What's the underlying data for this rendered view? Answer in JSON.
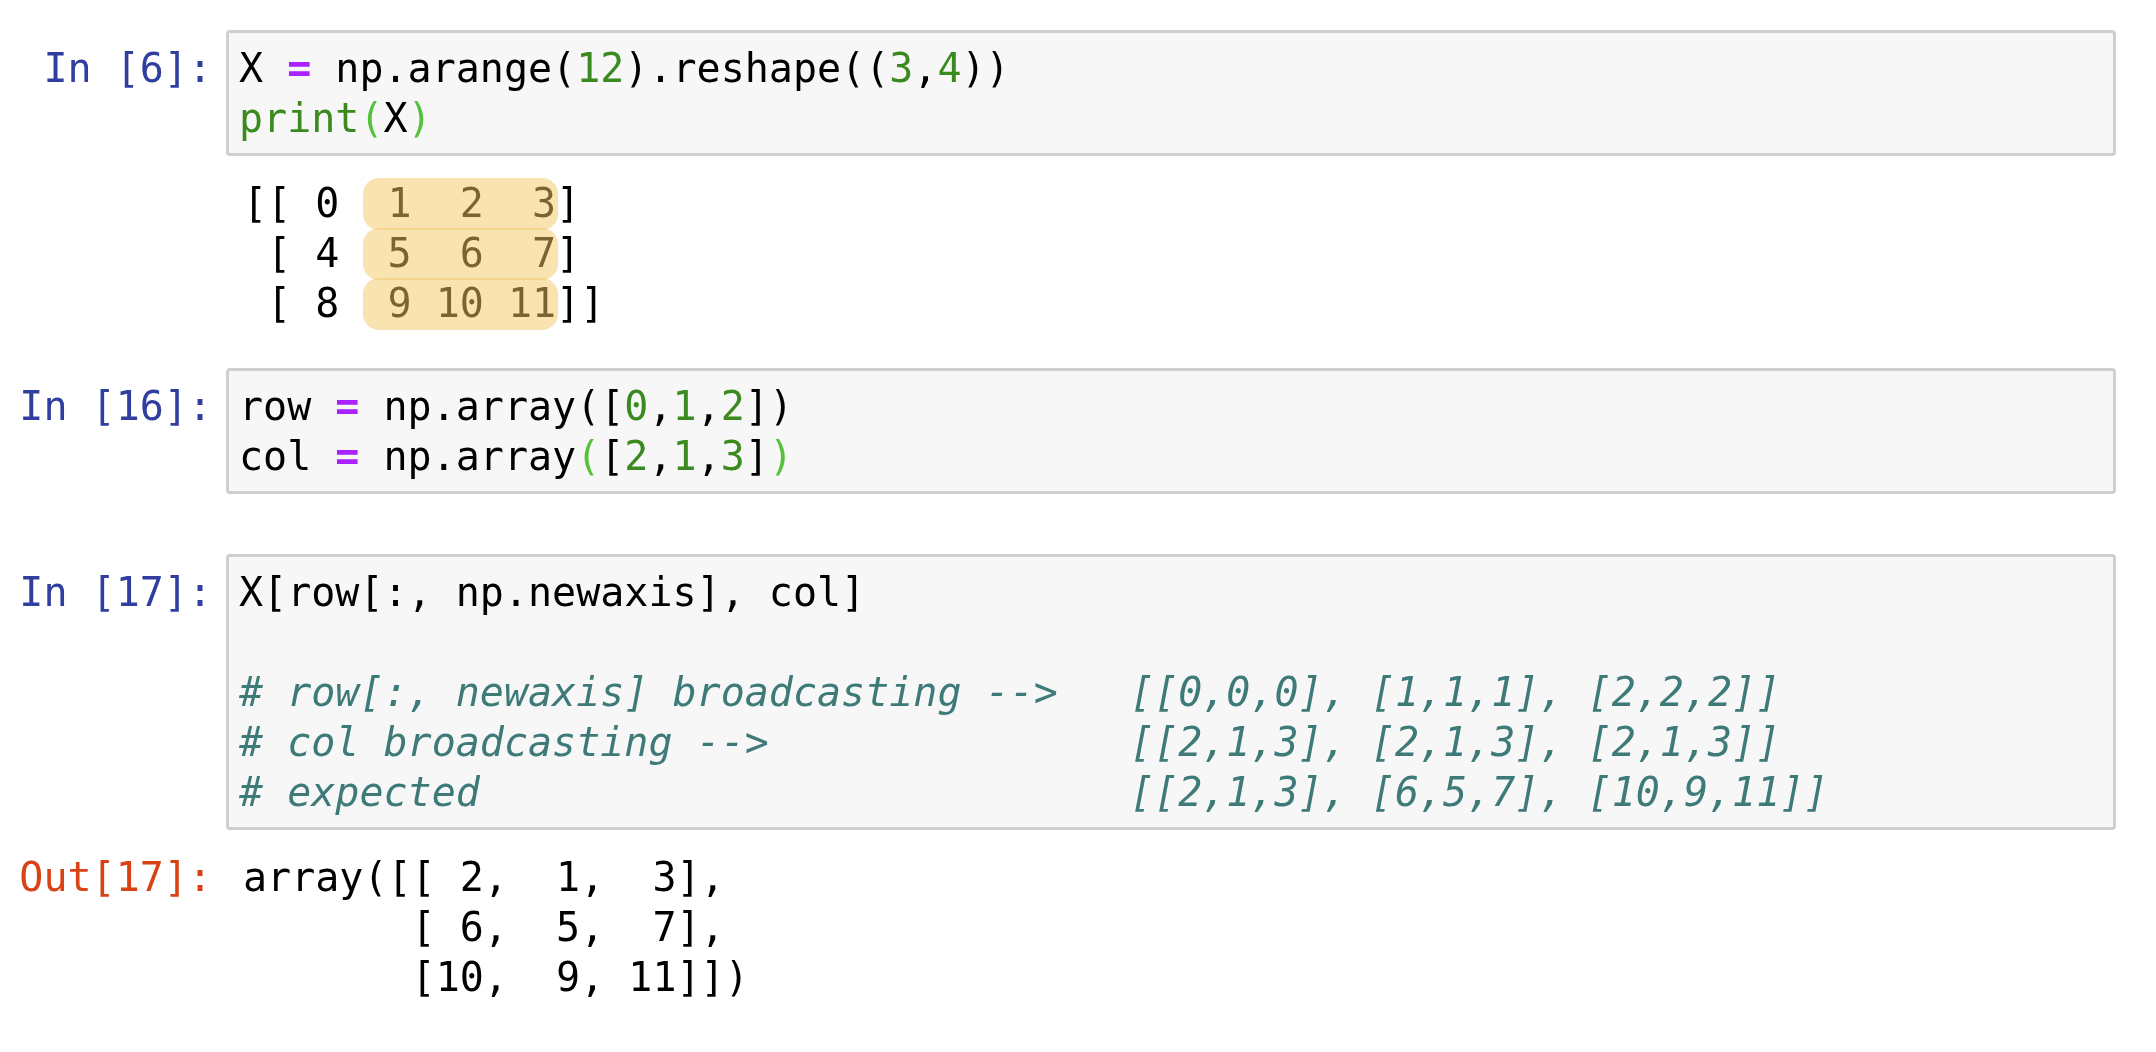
{
  "cells": [
    {
      "prompt": "In [6]:",
      "code": [
        {
          "blank_line_before": false,
          "tokens": [
            {
              "t": "X ",
              "kind": "plain"
            },
            {
              "t": "=",
              "kind": "op"
            },
            {
              "t": " np.arange(",
              "kind": "plain"
            },
            {
              "t": "12",
              "kind": "num"
            },
            {
              "t": ").reshape((",
              "kind": "plain"
            },
            {
              "t": "3",
              "kind": "num"
            },
            {
              "t": ",",
              "kind": "plain"
            },
            {
              "t": "4",
              "kind": "num"
            },
            {
              "t": "))",
              "kind": "plain"
            }
          ]
        },
        {
          "blank_line_before": false,
          "tokens": [
            {
              "t": "print",
              "kind": "builtin"
            },
            {
              "t": "(",
              "kind": "match"
            },
            {
              "t": "X",
              "kind": "plain"
            },
            {
              "t": ")",
              "kind": "match"
            }
          ]
        }
      ],
      "output": {
        "kind": "stream",
        "lines": [
          [
            {
              "text": "[[ 0 ",
              "highlighted": false
            },
            {
              "text": " 1  2  3",
              "highlighted": true
            },
            {
              "text": "]",
              "highlighted": false
            }
          ],
          [
            {
              "text": " [ 4 ",
              "highlighted": false
            },
            {
              "text": " 5  6  7",
              "highlighted": true
            },
            {
              "text": "]",
              "highlighted": false
            }
          ],
          [
            {
              "text": " [ 8 ",
              "highlighted": false
            },
            {
              "text": " 9 10 11",
              "highlighted": true
            },
            {
              "text": "]]",
              "highlighted": false
            }
          ]
        ]
      }
    },
    {
      "prompt": "In [16]:",
      "code": [
        {
          "blank_line_before": false,
          "tokens": [
            {
              "t": "row ",
              "kind": "plain"
            },
            {
              "t": "=",
              "kind": "op"
            },
            {
              "t": " np.array([",
              "kind": "plain"
            },
            {
              "t": "0",
              "kind": "num"
            },
            {
              "t": ",",
              "kind": "plain"
            },
            {
              "t": "1",
              "kind": "num"
            },
            {
              "t": ",",
              "kind": "plain"
            },
            {
              "t": "2",
              "kind": "num"
            },
            {
              "t": "])",
              "kind": "plain"
            }
          ]
        },
        {
          "blank_line_before": false,
          "tokens": [
            {
              "t": "col ",
              "kind": "plain"
            },
            {
              "t": "=",
              "kind": "op"
            },
            {
              "t": " np.array",
              "kind": "plain"
            },
            {
              "t": "(",
              "kind": "match"
            },
            {
              "t": "[",
              "kind": "plain"
            },
            {
              "t": "2",
              "kind": "num"
            },
            {
              "t": ",",
              "kind": "plain"
            },
            {
              "t": "1",
              "kind": "num"
            },
            {
              "t": ",",
              "kind": "plain"
            },
            {
              "t": "3",
              "kind": "num"
            },
            {
              "t": "]",
              "kind": "plain"
            },
            {
              "t": ")",
              "kind": "match"
            }
          ]
        }
      ]
    },
    {
      "prompt": "In [17]:",
      "code": [
        {
          "blank_line_before": false,
          "tokens": [
            {
              "t": "X[row[:, np.newaxis], col]",
              "kind": "plain"
            }
          ]
        },
        {
          "blank_line_before": true,
          "tokens": [
            {
              "t": "# row[:, newaxis] broadcasting -->   [[0,0,0], [1,1,1], [2,2,2]]",
              "kind": "comment"
            }
          ]
        },
        {
          "blank_line_before": false,
          "tokens": [
            {
              "t": "# col broadcasting -->               [[2,1,3], [2,1,3], [2,1,3]]",
              "kind": "comment"
            }
          ]
        },
        {
          "blank_line_before": false,
          "tokens": [
            {
              "t": "# expected                           [[2,1,3], [6,5,7], [10,9,11]]",
              "kind": "comment"
            }
          ]
        }
      ],
      "output": {
        "kind": "result",
        "prompt": "Out[17]:",
        "lines": [
          [
            {
              "text": "array([[ 2,  1,  3],",
              "highlighted": false
            }
          ],
          [
            {
              "text": "       [ 6,  5,  7],",
              "highlighted": false
            }
          ],
          [
            {
              "text": "       [10,  9, 11]])",
              "highlighted": false
            }
          ]
        ]
      }
    }
  ]
}
